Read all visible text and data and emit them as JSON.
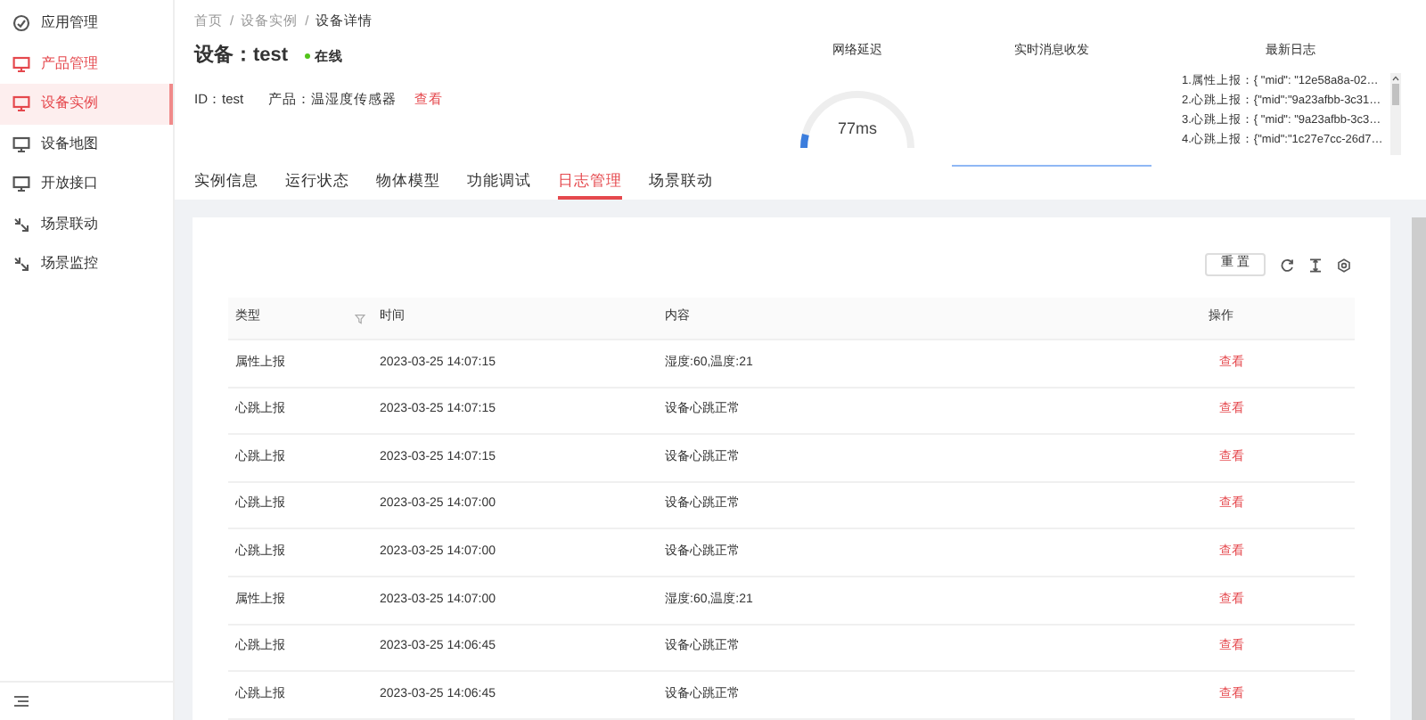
{
  "sidebar": {
    "items": [
      {
        "label": "应用管理",
        "kind": "app",
        "active": false,
        "selected": false
      },
      {
        "label": "产品管理",
        "kind": "monitor",
        "active": true,
        "selected": false
      },
      {
        "label": "设备实例",
        "kind": "monitor",
        "active": true,
        "selected": true
      },
      {
        "label": "设备地图",
        "kind": "monitor",
        "active": false,
        "selected": false
      },
      {
        "label": "开放接口",
        "kind": "monitor",
        "active": false,
        "selected": false
      },
      {
        "label": "场景联动",
        "kind": "scene",
        "active": false,
        "selected": false
      },
      {
        "label": "场景监控",
        "kind": "scene",
        "active": false,
        "selected": false
      }
    ]
  },
  "breadcrumb": {
    "separator": "/",
    "items": [
      "首页",
      "设备实例",
      "设备详情"
    ]
  },
  "device": {
    "title": "设备：",
    "name": "test",
    "status": "在线",
    "online": true,
    "id_label": "ID：",
    "id": "test",
    "product_label": "产品：",
    "product": "温湿度传感器",
    "view_link": "查看"
  },
  "monitors": {
    "latency": {
      "title": "网络延迟",
      "value": "77ms",
      "level": 0.08
    },
    "realtime": {
      "title": "实时消息收发"
    },
    "logs": {
      "title": "最新日志",
      "items": [
        "1.属性上报：{ \"mid\": \"12e58a8a-02…",
        "2.心跳上报：{\"mid\":\"9a23afbb-3c31…",
        "3.心跳上报：{ \"mid\": \"9a23afbb-3c3…",
        "4.心跳上报：{\"mid\":\"1c27e7cc-26d7…"
      ]
    }
  },
  "tabs": [
    {
      "label": "实例信息",
      "selected": false
    },
    {
      "label": "运行状态",
      "selected": false
    },
    {
      "label": "物体模型",
      "selected": false
    },
    {
      "label": "功能调试",
      "selected": false
    },
    {
      "label": "日志管理",
      "selected": true
    },
    {
      "label": "场景联动",
      "selected": false
    }
  ],
  "toolbar": {
    "reset": "重 置"
  },
  "table": {
    "columns": [
      "类型",
      "时间",
      "内容",
      "操作"
    ],
    "rows": [
      [
        "属性上报",
        "2023-03-25 14:07:15",
        "湿度:60,温度:21",
        "查看"
      ],
      [
        "心跳上报",
        "2023-03-25 14:07:15",
        "设备心跳正常",
        "查看"
      ],
      [
        "心跳上报",
        "2023-03-25 14:07:15",
        "设备心跳正常",
        "查看"
      ],
      [
        "心跳上报",
        "2023-03-25 14:07:00",
        "设备心跳正常",
        "查看"
      ],
      [
        "心跳上报",
        "2023-03-25 14:07:00",
        "设备心跳正常",
        "查看"
      ],
      [
        "属性上报",
        "2023-03-25 14:07:00",
        "湿度:60,温度:21",
        "查看"
      ],
      [
        "心跳上报",
        "2023-03-25 14:06:45",
        "设备心跳正常",
        "查看"
      ],
      [
        "心跳上报",
        "2023-03-25 14:06:45",
        "设备心跳正常",
        "查看"
      ]
    ]
  }
}
